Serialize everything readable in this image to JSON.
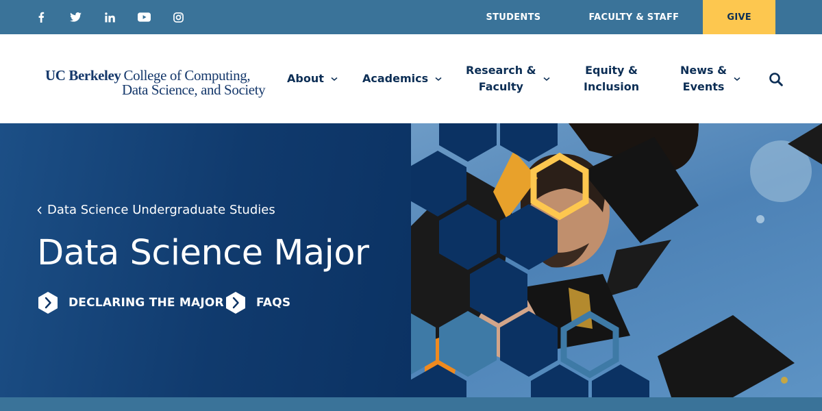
{
  "topbar": {
    "social": [
      {
        "icon": "facebook-icon"
      },
      {
        "icon": "twitter-icon"
      },
      {
        "icon": "linkedin-icon"
      },
      {
        "icon": "youtube-icon"
      },
      {
        "icon": "instagram-icon"
      }
    ],
    "links": {
      "students": "STUDENTS",
      "faculty_staff": "FACULTY & STAFF",
      "give": "GIVE"
    }
  },
  "logo": {
    "ucb": "UC Berkeley",
    "line1": "College of Computing,",
    "line2": "Data Science, and Society"
  },
  "nav": {
    "about": "About",
    "academics": "Academics",
    "research_1": "Research &",
    "research_2": "Faculty",
    "equity_1": "Equity &",
    "equity_2": "Inclusion",
    "news_1": "News &",
    "news_2": "Events"
  },
  "hero": {
    "breadcrumb": "Data Science Undergraduate Studies",
    "title": "Data Science Major",
    "cta_declaring": "DECLARING THE MAJOR",
    "cta_faqs": "FAQS"
  },
  "colors": {
    "topbar": "#3a7399",
    "navy": "#0c2e55",
    "give": "#fdc74f",
    "hex_navy": "#0b3263",
    "hex_light": "#3e7aa6",
    "hex_gold": "#fdc74f"
  }
}
